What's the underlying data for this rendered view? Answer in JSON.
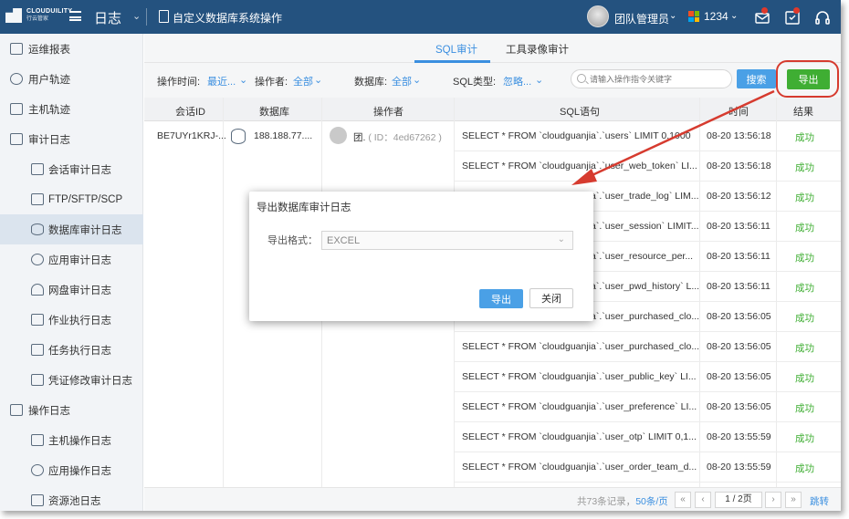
{
  "topbar": {
    "logo_line1": "CLOUDUILITY",
    "logo_line2": "行云管家",
    "module": "日志",
    "page_name": "自定义数据库系统操作",
    "user": "团队管理员",
    "tenant": "1234"
  },
  "sidebar": {
    "items": [
      {
        "label": "运维报表"
      },
      {
        "label": "用户轨迹"
      },
      {
        "label": "主机轨迹"
      },
      {
        "label": "审计日志"
      },
      {
        "label": "会话审计日志"
      },
      {
        "label": "FTP/SFTP/SCP"
      },
      {
        "label": "数据库审计日志"
      },
      {
        "label": "应用审计日志"
      },
      {
        "label": "网盘审计日志"
      },
      {
        "label": "作业执行日志"
      },
      {
        "label": "任务执行日志"
      },
      {
        "label": "凭证修改审计日志"
      },
      {
        "label": "操作日志"
      },
      {
        "label": "主机操作日志"
      },
      {
        "label": "应用操作日志"
      },
      {
        "label": "资源池日志"
      }
    ]
  },
  "tabs": [
    {
      "label": "SQL审计"
    },
    {
      "label": "工具录像审计"
    }
  ],
  "filters": {
    "time_label": "操作时间:",
    "time_value": "最近...",
    "operator_label": "操作者:",
    "operator_value": "全部",
    "db_label": "数据库:",
    "db_value": "全部",
    "sql_type_label": "SQL类型:",
    "sql_type_value": "忽略...",
    "search_placeholder": "请输入操作指令关键字",
    "search_button": "搜索",
    "export_button": "导出"
  },
  "table": {
    "headers": [
      "会话ID",
      "数据库",
      "操作者",
      "SQL语句",
      "时间",
      "结果"
    ],
    "session_id": "BE7UYr1KRJ-...",
    "database": "188.188.77....",
    "operator_name": "团.",
    "operator_id": "( ID：4ed67262 )",
    "rows": [
      {
        "sql": "SELECT * FROM `cloudguanjia`.`users` LIMIT 0,1000",
        "time": "08-20 13:56:18",
        "result": "成功"
      },
      {
        "sql": "SELECT * FROM `cloudguanjia`.`user_web_token` LI...",
        "time": "08-20 13:56:18",
        "result": "成功"
      },
      {
        "sql": "SELECT * FROM `cloudguanjia`.`user_trade_log` LIM...",
        "time": "08-20 13:56:12",
        "result": "成功"
      },
      {
        "sql": "SELECT * FROM `cloudguanjia`.`user_session` LIMIT...",
        "time": "08-20 13:56:11",
        "result": "成功"
      },
      {
        "sql": "SELECT * FROM `cloudguanjia`.`user_resource_per...",
        "time": "08-20 13:56:11",
        "result": "成功"
      },
      {
        "sql": "SELECT * FROM `cloudguanjia`.`user_pwd_history` L...",
        "time": "08-20 13:56:11",
        "result": "成功"
      },
      {
        "sql": "SELECT * FROM `cloudguanjia`.`user_purchased_clo...",
        "time": "08-20 13:56:05",
        "result": "成功"
      },
      {
        "sql": "SELECT * FROM `cloudguanjia`.`user_purchased_clo...",
        "time": "08-20 13:56:05",
        "result": "成功"
      },
      {
        "sql": "SELECT * FROM `cloudguanjia`.`user_public_key` LI...",
        "time": "08-20 13:56:05",
        "result": "成功"
      },
      {
        "sql": "SELECT * FROM `cloudguanjia`.`user_preference` LI...",
        "time": "08-20 13:56:05",
        "result": "成功"
      },
      {
        "sql": "SELECT * FROM `cloudguanjia`.`user_otp` LIMIT 0,1...",
        "time": "08-20 13:55:59",
        "result": "成功"
      },
      {
        "sql": "SELECT * FROM `cloudguanjia`.`user_order_team_d...",
        "time": "08-20 13:55:59",
        "result": "成功"
      }
    ]
  },
  "pager": {
    "total_prefix": "共73条记录，",
    "page_size": "50条/页",
    "first": "«",
    "prev": "‹",
    "page_info": "1 / 2页",
    "next": "›",
    "last": "»",
    "jump": "跳转"
  },
  "dialog": {
    "title": "导出数据库审计日志",
    "format_label": "导出格式：",
    "format_value": "EXCEL",
    "export_button": "导出",
    "close_button": "关闭"
  },
  "colors": {
    "topbar": "#24527f",
    "accent": "#3b8fe0",
    "success": "#3fae33",
    "highlight": "#d63b2f"
  }
}
